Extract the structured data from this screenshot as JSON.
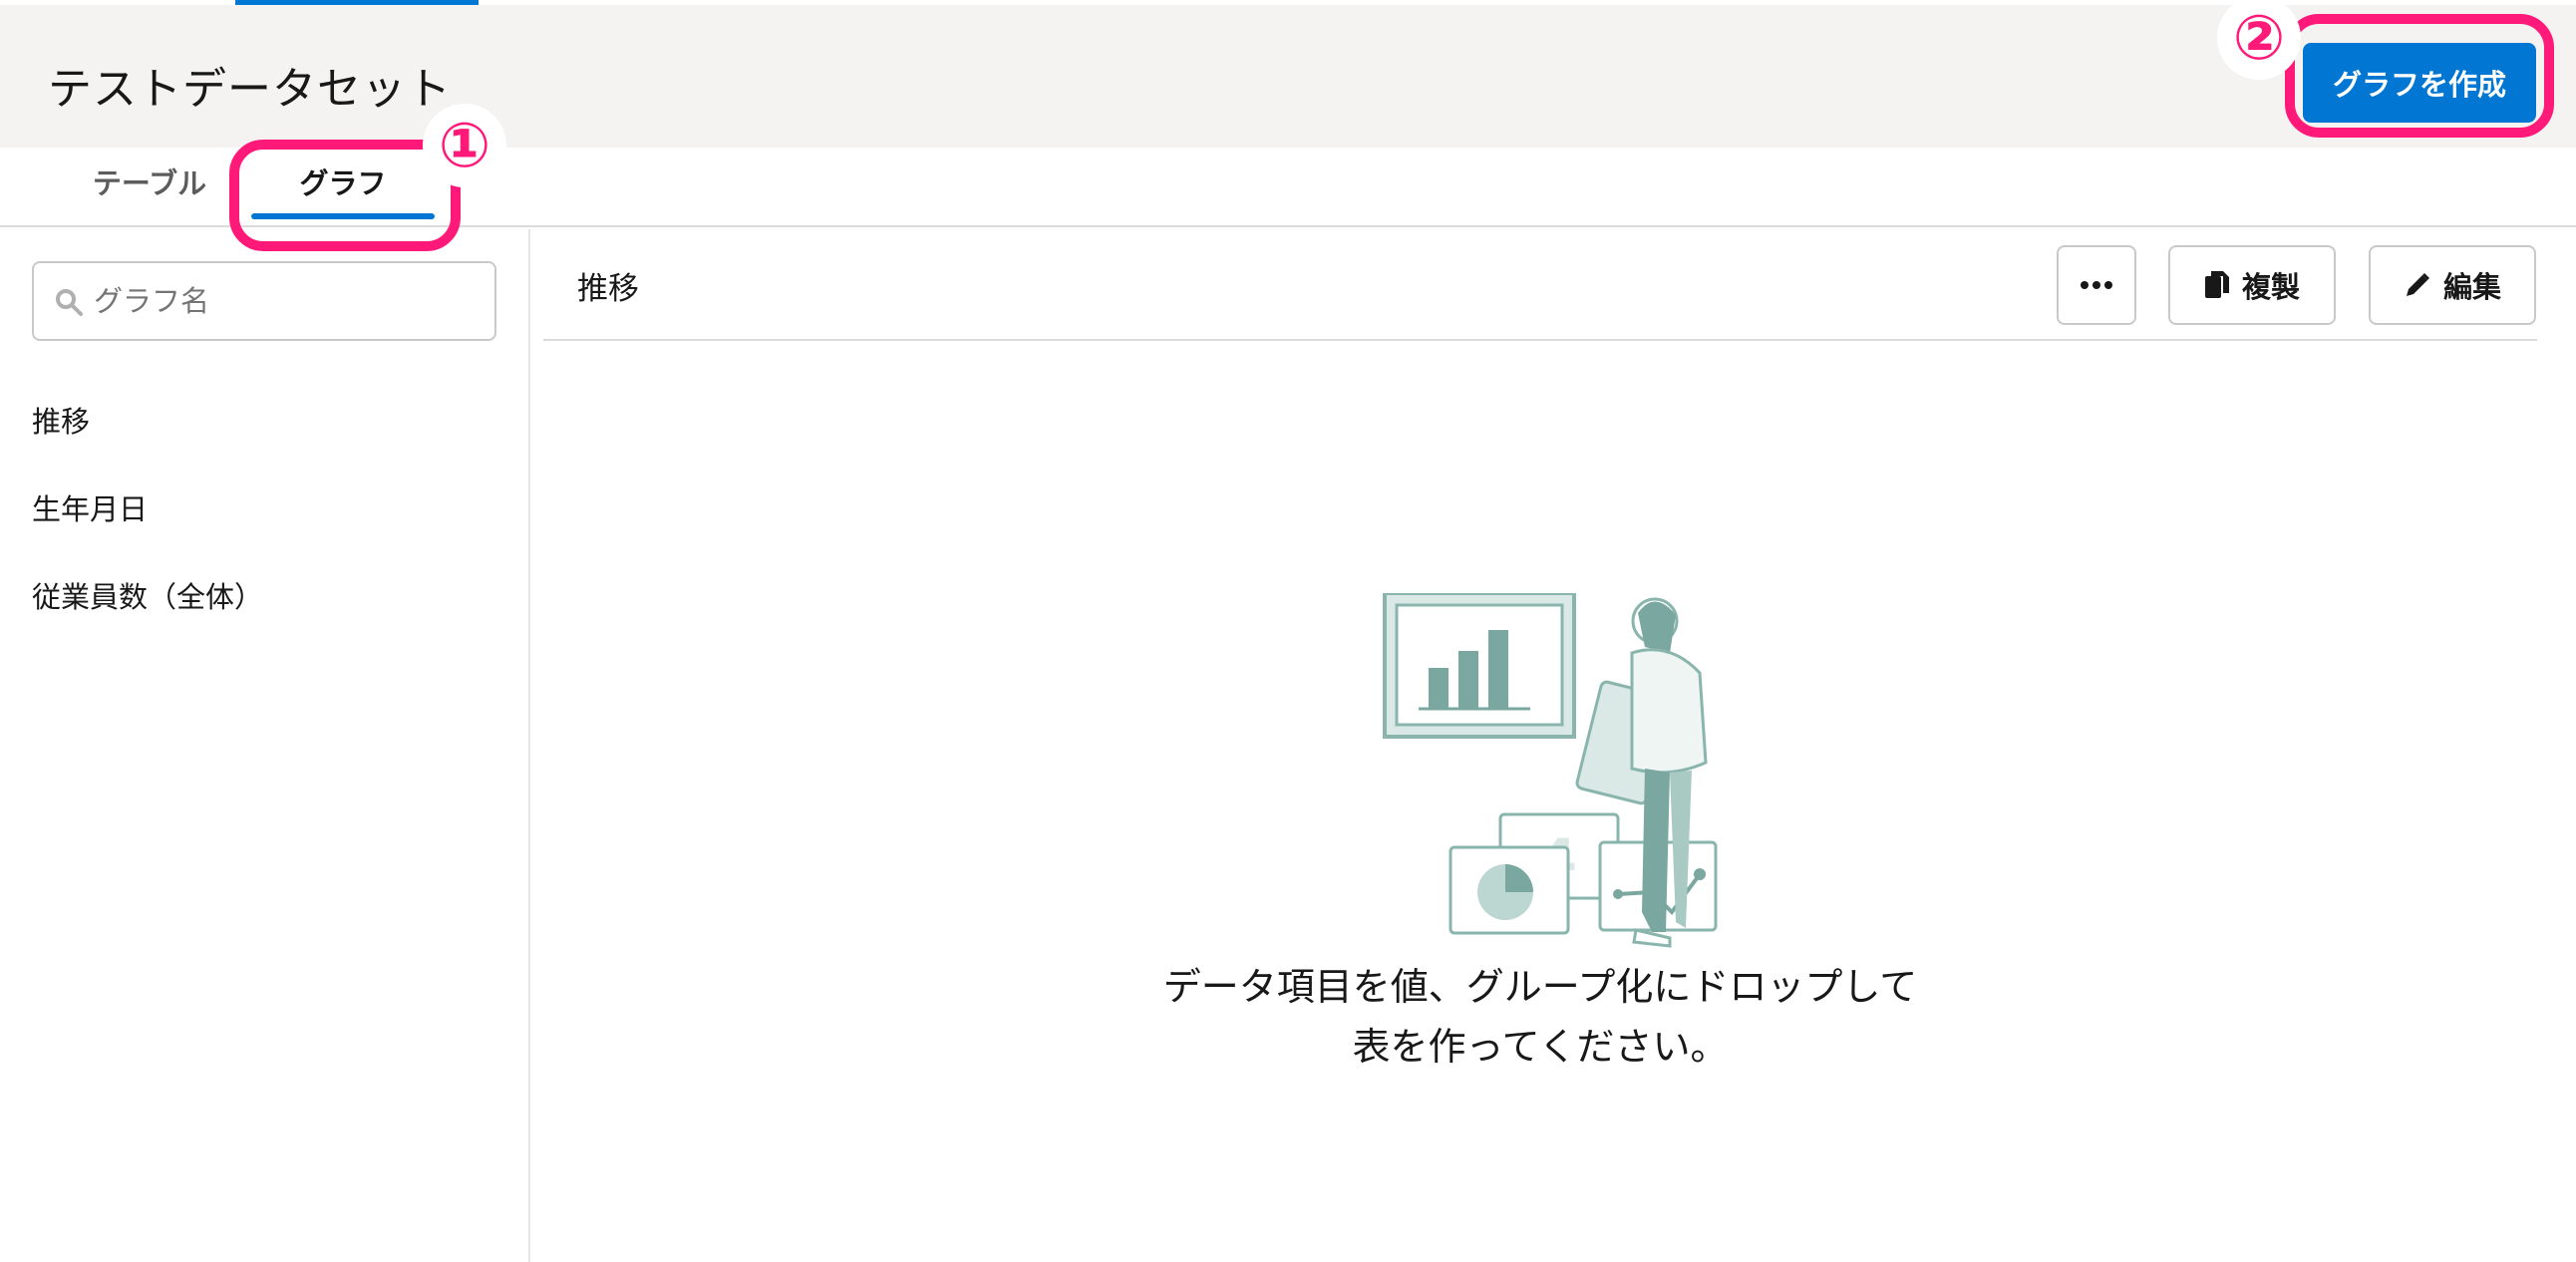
{
  "header": {
    "title": "テストデータセット",
    "create_button": "グラフを作成"
  },
  "tabs": [
    {
      "label": "テーブル",
      "active": false
    },
    {
      "label": "グラフ",
      "active": true
    }
  ],
  "sidebar": {
    "search_placeholder": "グラフ名",
    "items": [
      {
        "label": "推移"
      },
      {
        "label": "生年月日"
      },
      {
        "label": "従業員数（全体）"
      }
    ]
  },
  "main": {
    "title": "推移",
    "more_icon": "ellipsis-icon",
    "copy_label": "複製",
    "edit_label": "編集",
    "empty_message_line1": "データ項目を値、グループ化にドロップして",
    "empty_message_line2": "表を作ってください。",
    "illustration_number": "4"
  },
  "annotations": {
    "badge1": "①",
    "badge2": "②"
  },
  "colors": {
    "accent": "#0176d3",
    "annotation": "#ff1a7a",
    "illustration": "#8ab5ad"
  }
}
